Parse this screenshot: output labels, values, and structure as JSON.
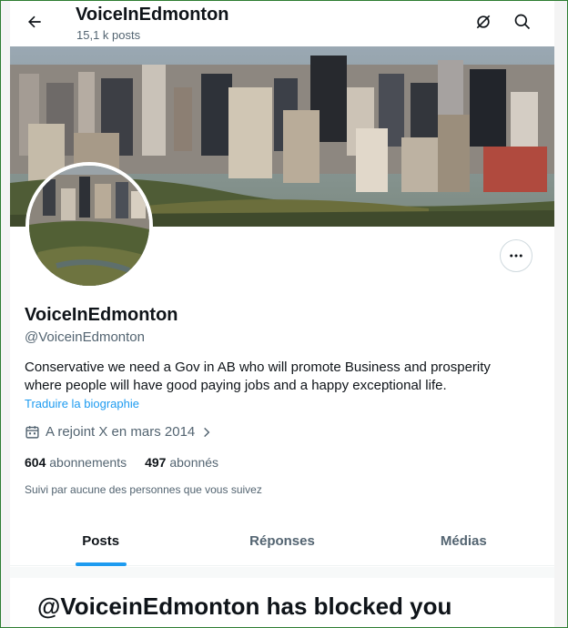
{
  "header": {
    "title": "VoiceInEdmonton",
    "post_count": "15,1 k posts"
  },
  "profile": {
    "display_name": "VoiceInEdmonton",
    "handle": "@VoiceinEdmonton",
    "bio_line1": "Conservative we need a Gov in AB who will promote Business and prosperity",
    "bio_line2": "where people will have good paying jobs and a happy exceptional life.",
    "translate_bio": "Traduire la biographie",
    "joined": "A rejoint X en mars 2014",
    "following_count": "604",
    "following_label": "abonnements",
    "followers_count": "497",
    "followers_label": "abonnés",
    "followed_by": "Suivi par aucune des personnes que vous suivez"
  },
  "tabs": [
    {
      "label": "Posts",
      "active": true
    },
    {
      "label": "Réponses",
      "active": false
    },
    {
      "label": "Médias",
      "active": false
    }
  ],
  "blocked": {
    "title": "@VoiceinEdmonton has blocked you"
  },
  "colors": {
    "accent": "#1d9bf0",
    "text_primary": "#0f1419",
    "text_secondary": "#536471",
    "frame_border": "#2e7d32"
  },
  "icons": {
    "back": "arrow-left-icon",
    "grok": "grok-icon",
    "search": "search-icon",
    "more": "more-horizontal-icon",
    "calendar": "calendar-icon",
    "chevron": "chevron-right-icon"
  }
}
